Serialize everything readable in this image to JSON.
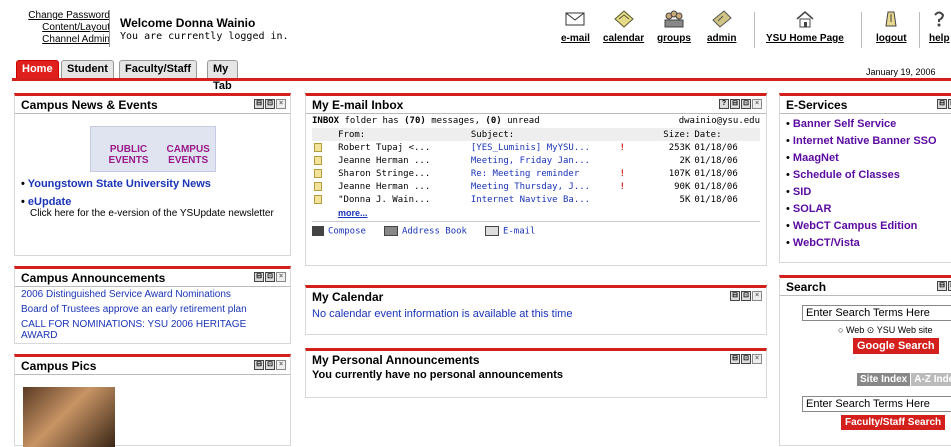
{
  "header": {
    "links": [
      "Change Password",
      "Content/Layout",
      "Channel Admin"
    ],
    "welcome": "Welcome Donna Wainio",
    "status": "You are currently logged in.",
    "nav": [
      {
        "label": "e-mail",
        "icon": "envelope-icon"
      },
      {
        "label": "calendar",
        "icon": "calendar-icon"
      },
      {
        "label": "groups",
        "icon": "groups-icon"
      },
      {
        "label": "admin",
        "icon": "admin-icon"
      },
      {
        "label": "YSU Home Page",
        "icon": "home-icon"
      },
      {
        "label": "logout",
        "icon": "logout-icon"
      },
      {
        "label": "help",
        "icon": "help-icon"
      }
    ]
  },
  "tabs": [
    "Home",
    "Student",
    "Faculty/Staff",
    "My Tab"
  ],
  "date": "January 19, 2006",
  "news": {
    "title": "Campus News & Events",
    "img_public": "PUBLIC\nEVENTS",
    "img_campus": "CAMPUS\nEVENTS",
    "link1": "Youngstown State University News",
    "link2": "eUpdate",
    "desc": "Click here for the e-version of the YSUpdate newsletter"
  },
  "announcements": {
    "title": "Campus Announcements",
    "items": [
      "2006 Distinguished Service Award Nominations",
      "Board of Trustees approve an early retirement plan",
      "CALL FOR NOMINATIONS: YSU 2006 HERITAGE AWARD"
    ]
  },
  "pics": {
    "title": "Campus Pics"
  },
  "inbox": {
    "title": "My E-mail Inbox",
    "summary_label": "INBOX",
    "summary_rest": " folder has ",
    "count": "(70)",
    "summary_mid": " messages, ",
    "unread": "(0)",
    "summary_end": " unread",
    "address": "dwainio@ysu.edu",
    "columns": [
      "From:",
      "Subject:",
      "",
      "Size:",
      "Date:"
    ],
    "rows": [
      {
        "from": "Robert Tupaj <...",
        "subject": "[YES_Luminis] MyYSU...",
        "flag": "!",
        "size": "253K",
        "date": "01/18/06"
      },
      {
        "from": "Jeanne Herman ...",
        "subject": "Meeting, Friday Jan...",
        "flag": "",
        "size": "2K",
        "date": "01/18/06"
      },
      {
        "from": "Sharon Stringe...",
        "subject": "Re: Meeting reminder",
        "flag": "!",
        "size": "107K",
        "date": "01/18/06"
      },
      {
        "from": "Jeanne Herman ...",
        "subject": "Meeting Thursday, J...",
        "flag": "!",
        "size": "90K",
        "date": "01/18/06"
      },
      {
        "from": "\"Donna J. Wain...",
        "subject": "Internet Navtive Ba...",
        "flag": "",
        "size": "5K",
        "date": "01/18/06"
      }
    ],
    "more": "more...",
    "actions": [
      "Compose",
      "Address Book",
      "E-mail"
    ]
  },
  "calendar": {
    "title": "My Calendar",
    "text": "No calendar event information is available at this time"
  },
  "personal": {
    "title": "My Personal Announcements",
    "text": "You currently have no personal announcements"
  },
  "eservices": {
    "title": "E-Services",
    "items": [
      "Banner Self Service",
      "Internet Native Banner SSO",
      "MaagNet",
      "Schedule of Classes",
      "SID",
      "SOLAR",
      "WebCT Campus Edition",
      "WebCT/Vista"
    ]
  },
  "search": {
    "title": "Search",
    "input1": "Enter Search Terms Here",
    "radio_web": "Web",
    "radio_ysu": "YSU Web site",
    "google_btn": "Google Search",
    "site_index": "Site Index",
    "az_index": "A-Z Index",
    "input2": "Enter Search Terms Here",
    "faculty_btn": "Faculty/Staff Search"
  },
  "colors": {
    "accent": "#d4201c",
    "link_blue": "#1a34b8",
    "link_purple": "#5a0aa0"
  }
}
